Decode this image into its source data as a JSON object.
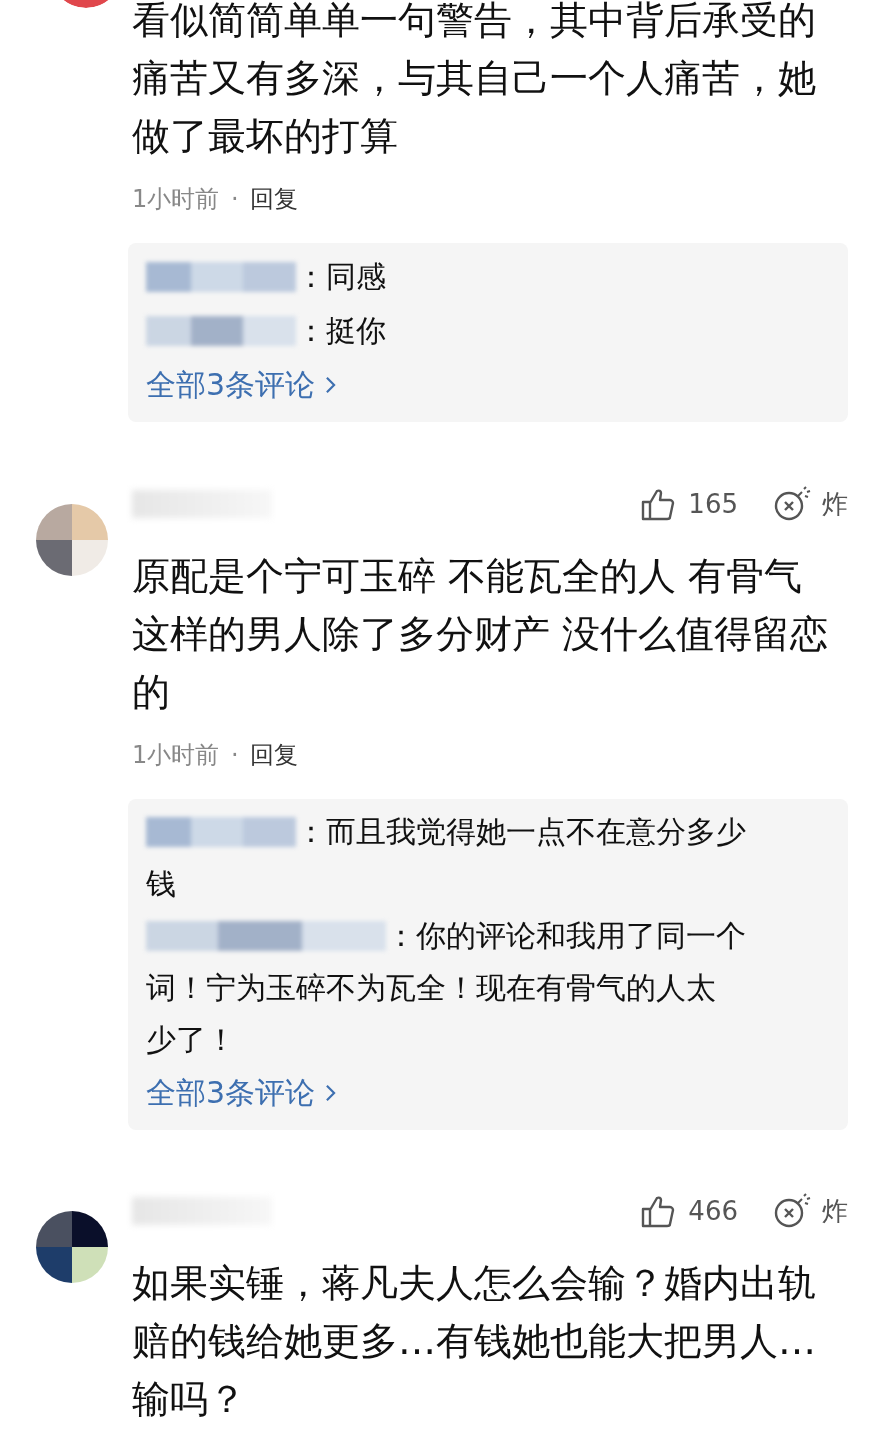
{
  "comments": [
    {
      "text_lines": [
        "看似简简单单一句警告，其中背后承受的",
        "痛苦又有多深，与其自己一个人痛苦，她",
        "做了最坏的打算"
      ],
      "time": "1小时前",
      "separator": "·",
      "reply_label": "回复",
      "replies": [
        {
          "lines": [
            "：同感"
          ]
        },
        {
          "lines": [
            "：挺你"
          ]
        }
      ],
      "more_link": "全部3条评论"
    },
    {
      "likes": "165",
      "bomb_label": "炸",
      "text_lines": [
        "原配是个宁可玉碎 不能瓦全的人 有骨气",
        "这样的男人除了多分财产 没什么值得留恋",
        "的"
      ],
      "time": "1小时前",
      "separator": "·",
      "reply_label": "回复",
      "replies": [
        {
          "lines": [
            "：而且我觉得她一点不在意分多少",
            "钱"
          ]
        },
        {
          "lines": [
            "：你的评论和我用了同一个",
            "词！宁为玉碎不为瓦全！现在有骨气的人太",
            "少了！"
          ]
        }
      ],
      "more_link": "全部3条评论"
    },
    {
      "likes": "466",
      "bomb_label": "炸",
      "text_lines": [
        "如果实锤，蒋凡夫人怎么会输？婚内出轨",
        "赔的钱给她更多…有钱她也能大把男人…",
        "输吗？"
      ]
    }
  ]
}
